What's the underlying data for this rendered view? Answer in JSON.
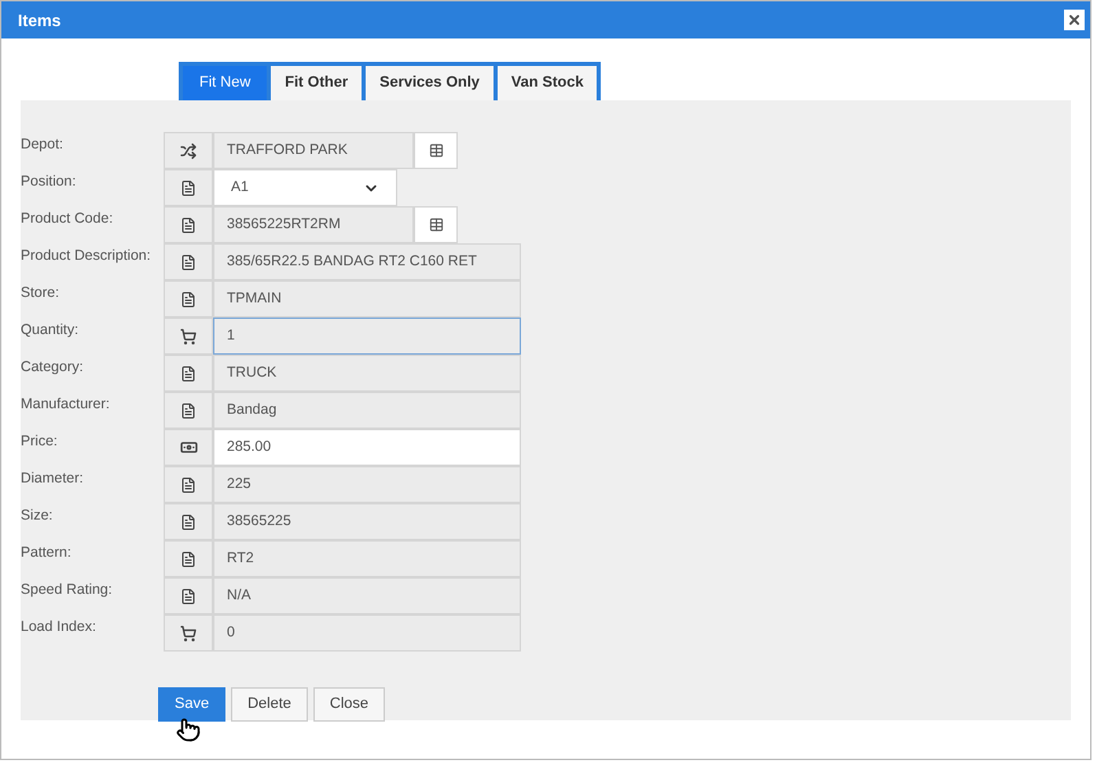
{
  "window": {
    "title": "Items"
  },
  "tabs": [
    {
      "label": "Fit New",
      "selected": true
    },
    {
      "label": "Fit Other",
      "selected": false
    },
    {
      "label": "Services Only",
      "selected": false
    },
    {
      "label": "Van Stock",
      "selected": false
    }
  ],
  "fields": [
    {
      "label": "Depot:",
      "kind": "location",
      "value": "TRAFFORD PARK",
      "editable": false,
      "focused": false
    },
    {
      "label": "Position:",
      "kind": "select",
      "value": "A1",
      "editable": true,
      "focused": false
    },
    {
      "label": "Product Code:",
      "kind": "lookup",
      "value": "38565225RT2RM",
      "editable": false,
      "focused": false
    },
    {
      "label": "Product Description:",
      "kind": "text",
      "value": "385/65R22.5 BANDAG RT2 C160 RET",
      "editable": false,
      "focused": false
    },
    {
      "label": "Store:",
      "kind": "text",
      "value": "TPMAIN",
      "editable": false,
      "focused": false
    },
    {
      "label": "Quantity:",
      "kind": "quantity",
      "value": "1",
      "editable": false,
      "focused": true
    },
    {
      "label": "Category:",
      "kind": "text",
      "value": "TRUCK",
      "editable": false,
      "focused": false
    },
    {
      "label": "Manufacturer:",
      "kind": "text",
      "value": "Bandag",
      "editable": false,
      "focused": false
    },
    {
      "label": "Price:",
      "kind": "price",
      "value": "285.00",
      "editable": true,
      "focused": false
    },
    {
      "label": "Diameter:",
      "kind": "text",
      "value": "225",
      "editable": false,
      "focused": false
    },
    {
      "label": "Size:",
      "kind": "text",
      "value": "38565225",
      "editable": false,
      "focused": false
    },
    {
      "label": "Pattern:",
      "kind": "text",
      "value": "RT2",
      "editable": false,
      "focused": false
    },
    {
      "label": "Speed Rating:",
      "kind": "text",
      "value": "N/A",
      "editable": false,
      "focused": false
    },
    {
      "label": "Load Index:",
      "kind": "quantity",
      "value": "0",
      "editable": false,
      "focused": false
    }
  ],
  "buttons": [
    {
      "label": "Save",
      "primary": true
    },
    {
      "label": "Delete",
      "primary": false
    },
    {
      "label": "Close",
      "primary": false
    }
  ]
}
